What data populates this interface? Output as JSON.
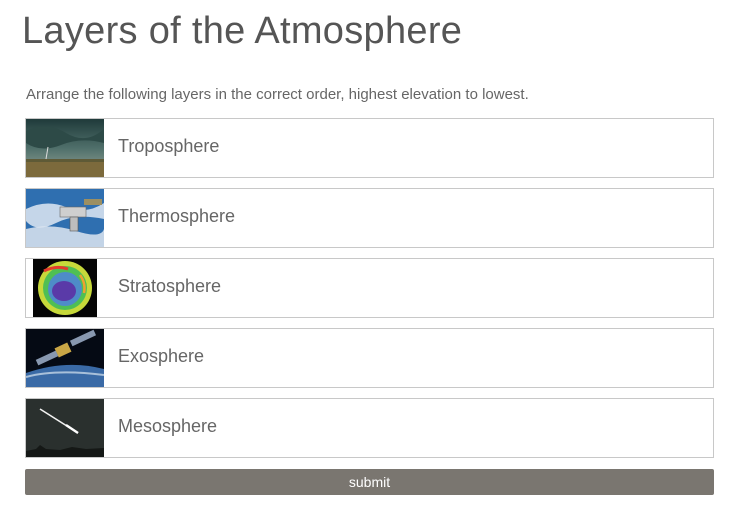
{
  "page": {
    "title": "Layers of the Atmosphere",
    "instructions": "Arrange the following layers in the correct order, highest elevation to lowest."
  },
  "layers": [
    {
      "label": "Troposphere",
      "image": "storm-clouds-photo"
    },
    {
      "label": "Thermosphere",
      "image": "space-station-photo"
    },
    {
      "label": "Stratosphere",
      "image": "ozone-hole-map"
    },
    {
      "label": "Exosphere",
      "image": "satellite-photo"
    },
    {
      "label": "Mesosphere",
      "image": "meteor-photo"
    }
  ],
  "submit": {
    "label": "submit"
  },
  "colors": {
    "button": "#7a7670",
    "border": "#c8c8c8",
    "text": "#666666"
  }
}
